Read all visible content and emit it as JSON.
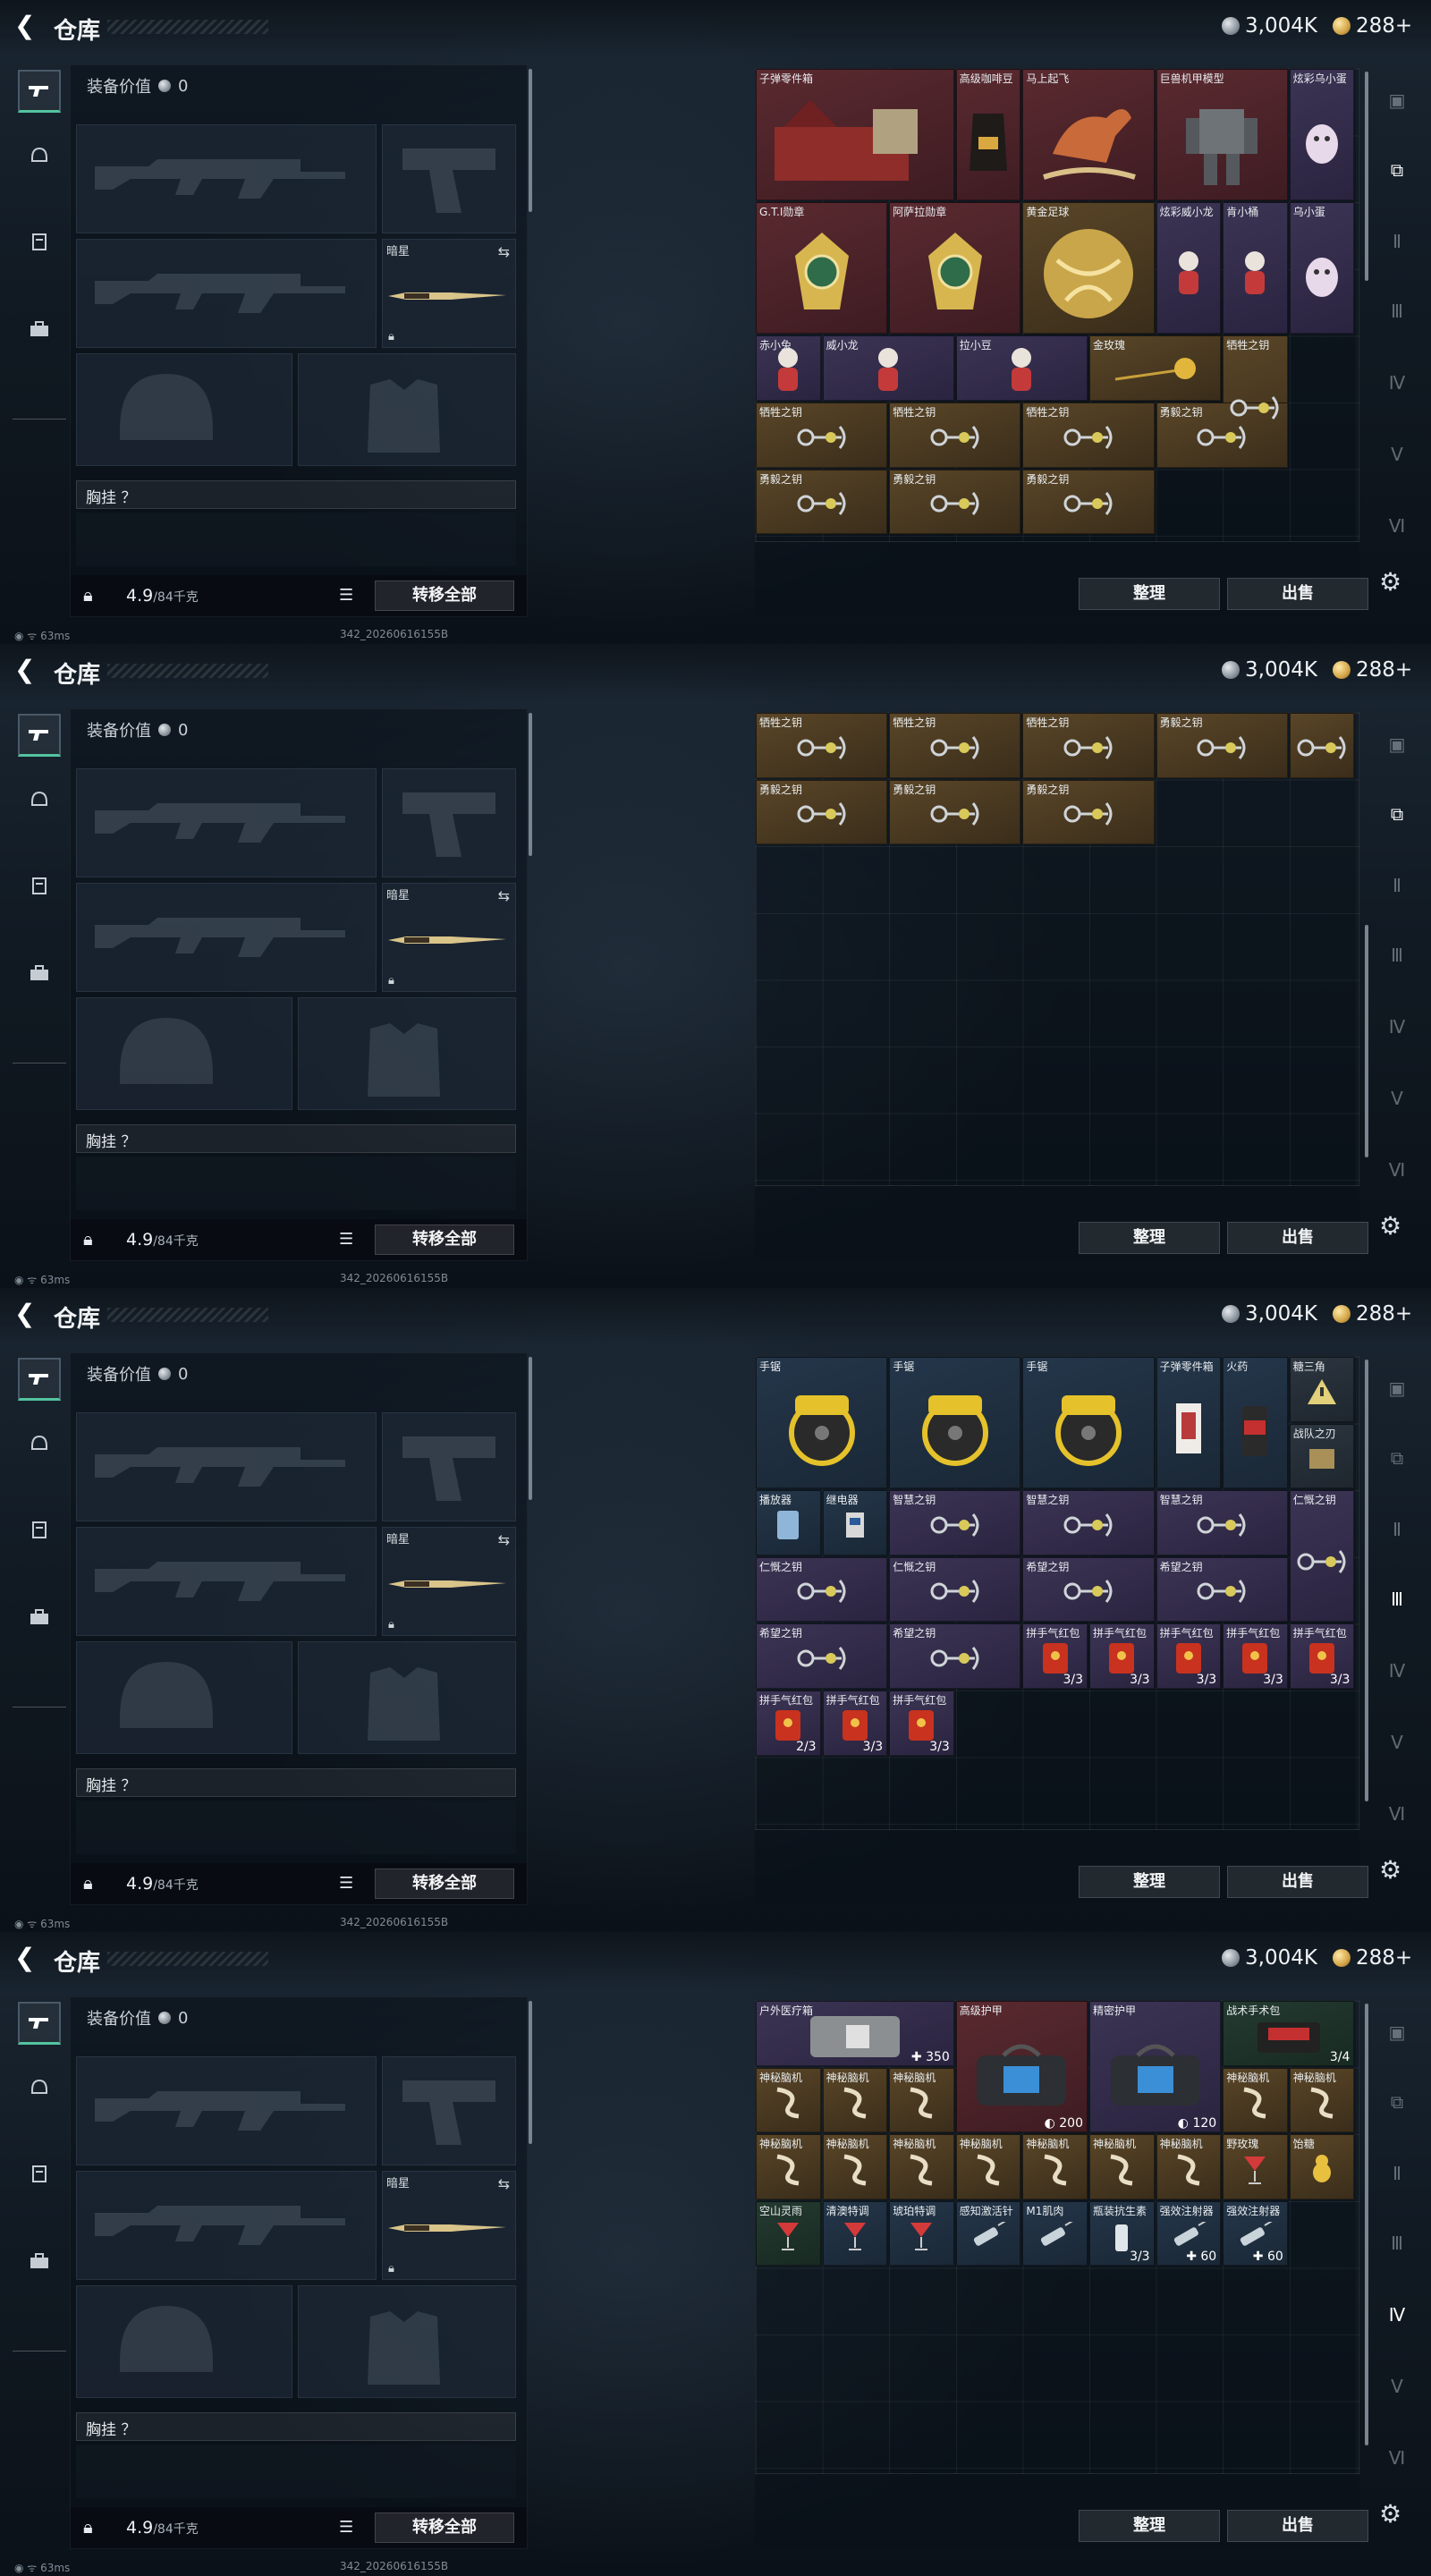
{
  "header": {
    "title": "仓库",
    "silver": "3,004K",
    "gold": "288+"
  },
  "equipment": {
    "value_label": "装备价值",
    "value": "0",
    "melee_label": "暗星",
    "rig_label": "胸挂 ？",
    "weight_value": "4.9",
    "weight_max": "/84千克",
    "transfer_button": "转移全部"
  },
  "footer": {
    "ping": "63ms",
    "build": "342_20260616155B"
  },
  "stash_buttons": {
    "sort": "整理",
    "sell": "出售"
  },
  "screens": [
    {
      "items": [
        {
          "name": "子弹零件箱",
          "c": 0,
          "r": 0,
          "w": 3,
          "h": 2,
          "col": "red",
          "icon": "toolbox-icon"
        },
        {
          "name": "高级咖啡豆",
          "c": 3,
          "r": 0,
          "w": 1,
          "h": 2,
          "col": "red",
          "icon": "coffee-bag-icon"
        },
        {
          "name": "马上起飞",
          "c": 4,
          "r": 0,
          "w": 2,
          "h": 2,
          "col": "red",
          "icon": "rocking-horse-icon"
        },
        {
          "name": "巨兽机甲模型",
          "c": 6,
          "r": 0,
          "w": 2,
          "h": 2,
          "col": "red",
          "icon": "mech-model-icon"
        },
        {
          "name": "炫彩乌小蛋",
          "c": 8,
          "r": 0,
          "w": 1,
          "h": 2,
          "col": "purple",
          "icon": "egg-toy-icon"
        },
        {
          "name": "G.T.I勋章",
          "c": 0,
          "r": 2,
          "w": 2,
          "h": 2,
          "col": "red",
          "icon": "medal-icon"
        },
        {
          "name": "阿萨拉勋章",
          "c": 2,
          "r": 2,
          "w": 2,
          "h": 2,
          "col": "red",
          "icon": "medal-icon"
        },
        {
          "name": "黄金足球",
          "c": 4,
          "r": 2,
          "w": 2,
          "h": 2,
          "col": "gold",
          "icon": "gold-ball-icon"
        },
        {
          "name": "炫彩威小龙",
          "c": 6,
          "r": 2,
          "w": 1,
          "h": 2,
          "col": "purple",
          "icon": "figure-icon"
        },
        {
          "name": "肯小桶",
          "c": 7,
          "r": 2,
          "w": 1,
          "h": 2,
          "col": "purple",
          "icon": "figure-icon"
        },
        {
          "name": "乌小蛋",
          "c": 8,
          "r": 2,
          "w": 1,
          "h": 2,
          "col": "purple",
          "icon": "egg-toy-icon"
        },
        {
          "name": "赤小兔",
          "c": 0,
          "r": 4,
          "w": 1,
          "h": 1,
          "col": "purple",
          "icon": "figure-icon"
        },
        {
          "name": "威小龙",
          "c": 1,
          "r": 4,
          "w": 2,
          "h": 1,
          "col": "purple",
          "icon": "figure-icon"
        },
        {
          "name": "拉小豆",
          "c": 3,
          "r": 4,
          "w": 2,
          "h": 1,
          "col": "purple",
          "icon": "figure-icon"
        },
        {
          "name": "金玫瑰",
          "c": 5,
          "r": 4,
          "w": 2,
          "h": 1,
          "col": "gold",
          "icon": "rose-icon"
        },
        {
          "name": "牺牲之钥",
          "c": 7,
          "r": 4,
          "w": 1,
          "h": 2,
          "col": "gold",
          "icon": "key-icon"
        },
        {
          "name": "牺牲之钥",
          "c": 0,
          "r": 5,
          "w": 2,
          "h": 1,
          "col": "gold",
          "icon": "key-icon"
        },
        {
          "name": "牺牲之钥",
          "c": 2,
          "r": 5,
          "w": 2,
          "h": 1,
          "col": "gold",
          "icon": "key-icon"
        },
        {
          "name": "牺牲之钥",
          "c": 4,
          "r": 5,
          "w": 2,
          "h": 1,
          "col": "gold",
          "icon": "key-icon"
        },
        {
          "name": "勇毅之钥",
          "c": 6,
          "r": 5,
          "w": 2,
          "h": 1,
          "col": "gold",
          "icon": "key-icon"
        },
        {
          "name": "勇毅之钥",
          "c": 0,
          "r": 6,
          "w": 2,
          "h": 1,
          "col": "gold",
          "icon": "key-icon"
        },
        {
          "name": "勇毅之钥",
          "c": 2,
          "r": 6,
          "w": 2,
          "h": 1,
          "col": "gold",
          "icon": "key-icon"
        },
        {
          "name": "勇毅之钥",
          "c": 4,
          "r": 6,
          "w": 2,
          "h": 1,
          "col": "gold",
          "icon": "key-icon"
        }
      ],
      "scroll": {
        "top": 0,
        "len": 0.45
      },
      "active_tab": 1
    },
    {
      "items": [
        {
          "name": "牺牲之钥",
          "c": 0,
          "r": 0,
          "w": 2,
          "h": 1,
          "col": "gold",
          "icon": "key-icon"
        },
        {
          "name": "牺牲之钥",
          "c": 2,
          "r": 0,
          "w": 2,
          "h": 1,
          "col": "gold",
          "icon": "key-icon"
        },
        {
          "name": "牺牲之钥",
          "c": 4,
          "r": 0,
          "w": 2,
          "h": 1,
          "col": "gold",
          "icon": "key-icon"
        },
        {
          "name": "勇毅之钥",
          "c": 6,
          "r": 0,
          "w": 2,
          "h": 1,
          "col": "gold",
          "icon": "key-icon"
        },
        {
          "name": "",
          "c": 8,
          "r": 0,
          "w": 1,
          "h": 1,
          "col": "gold",
          "icon": "key-icon"
        },
        {
          "name": "勇毅之钥",
          "c": 0,
          "r": 1,
          "w": 2,
          "h": 1,
          "col": "gold",
          "icon": "key-icon"
        },
        {
          "name": "勇毅之钥",
          "c": 2,
          "r": 1,
          "w": 2,
          "h": 1,
          "col": "gold",
          "icon": "key-icon"
        },
        {
          "name": "勇毅之钥",
          "c": 4,
          "r": 1,
          "w": 2,
          "h": 1,
          "col": "gold",
          "icon": "key-icon"
        }
      ],
      "scroll": {
        "top": 0.45,
        "len": 0.5
      },
      "active_tab": 1
    },
    {
      "items": [
        {
          "name": "手锯",
          "c": 0,
          "r": 0,
          "w": 2,
          "h": 2,
          "col": "blue",
          "icon": "saw-icon"
        },
        {
          "name": "手锯",
          "c": 2,
          "r": 0,
          "w": 2,
          "h": 2,
          "col": "blue",
          "icon": "saw-icon"
        },
        {
          "name": "手锯",
          "c": 4,
          "r": 0,
          "w": 2,
          "h": 2,
          "col": "blue",
          "icon": "saw-icon"
        },
        {
          "name": "子弹零件箱",
          "c": 6,
          "r": 0,
          "w": 1,
          "h": 2,
          "col": "blue",
          "icon": "card-icon"
        },
        {
          "name": "火药",
          "c": 7,
          "r": 0,
          "w": 1,
          "h": 2,
          "col": "blue",
          "icon": "powder-icon"
        },
        {
          "name": "糖三角",
          "c": 8,
          "r": 0,
          "w": 1,
          "h": 1,
          "col": "gray",
          "icon": "warning-icon"
        },
        {
          "name": "战队之刃",
          "c": 8,
          "r": 1,
          "w": 1,
          "h": 1,
          "col": "gray",
          "icon": "box-icon"
        },
        {
          "name": "播放器",
          "c": 0,
          "r": 2,
          "w": 1,
          "h": 1,
          "col": "blue",
          "icon": "player-icon"
        },
        {
          "name": "继电器",
          "c": 1,
          "r": 2,
          "w": 1,
          "h": 1,
          "col": "blue",
          "icon": "relay-icon"
        },
        {
          "name": "智慧之钥",
          "c": 2,
          "r": 2,
          "w": 2,
          "h": 1,
          "col": "purple",
          "icon": "key-icon"
        },
        {
          "name": "智慧之钥",
          "c": 4,
          "r": 2,
          "w": 2,
          "h": 1,
          "col": "purple",
          "icon": "key-icon"
        },
        {
          "name": "智慧之钥",
          "c": 6,
          "r": 2,
          "w": 2,
          "h": 1,
          "col": "purple",
          "icon": "key-icon"
        },
        {
          "name": "仁慨之钥",
          "c": 8,
          "r": 2,
          "w": 1,
          "h": 2,
          "col": "purple",
          "icon": "key-icon"
        },
        {
          "name": "仁慨之钥",
          "c": 0,
          "r": 3,
          "w": 2,
          "h": 1,
          "col": "purple",
          "icon": "key-icon"
        },
        {
          "name": "仁慨之钥",
          "c": 2,
          "r": 3,
          "w": 2,
          "h": 1,
          "col": "purple",
          "icon": "key-icon"
        },
        {
          "name": "希望之钥",
          "c": 4,
          "r": 3,
          "w": 2,
          "h": 1,
          "col": "purple",
          "icon": "key-icon"
        },
        {
          "name": "希望之钥",
          "c": 6,
          "r": 3,
          "w": 2,
          "h": 1,
          "col": "purple",
          "icon": "key-icon"
        },
        {
          "name": "希望之钥",
          "c": 0,
          "r": 4,
          "w": 2,
          "h": 1,
          "col": "purple",
          "icon": "key-icon"
        },
        {
          "name": "希望之钥",
          "c": 2,
          "r": 4,
          "w": 2,
          "h": 1,
          "col": "purple",
          "icon": "key-icon"
        },
        {
          "name": "拼手气红包",
          "c": 4,
          "r": 4,
          "w": 1,
          "h": 1,
          "col": "purple",
          "icon": "red-envelope-icon",
          "count": "3/3"
        },
        {
          "name": "拼手气红包",
          "c": 5,
          "r": 4,
          "w": 1,
          "h": 1,
          "col": "purple",
          "icon": "red-envelope-icon",
          "count": "3/3"
        },
        {
          "name": "拼手气红包",
          "c": 6,
          "r": 4,
          "w": 1,
          "h": 1,
          "col": "purple",
          "icon": "red-envelope-icon",
          "count": "3/3"
        },
        {
          "name": "拼手气红包",
          "c": 7,
          "r": 4,
          "w": 1,
          "h": 1,
          "col": "purple",
          "icon": "red-envelope-icon",
          "count": "3/3"
        },
        {
          "name": "拼手气红包",
          "c": 8,
          "r": 4,
          "w": 1,
          "h": 1,
          "col": "purple",
          "icon": "red-envelope-icon",
          "count": "3/3"
        },
        {
          "name": "拼手气红包",
          "c": 0,
          "r": 5,
          "w": 1,
          "h": 1,
          "col": "purple",
          "icon": "red-envelope-icon",
          "count": "2/3"
        },
        {
          "name": "拼手气红包",
          "c": 1,
          "r": 5,
          "w": 1,
          "h": 1,
          "col": "purple",
          "icon": "red-envelope-icon",
          "count": "3/3"
        },
        {
          "name": "拼手气红包",
          "c": 2,
          "r": 5,
          "w": 1,
          "h": 1,
          "col": "purple",
          "icon": "red-envelope-icon",
          "count": "3/3"
        }
      ],
      "scroll": {
        "top": 0,
        "len": 0.95
      },
      "active_tab": 3
    },
    {
      "items": [
        {
          "name": "户外医疗箱",
          "c": 0,
          "r": 0,
          "w": 3,
          "h": 1,
          "col": "purple",
          "icon": "medkit-icon",
          "count": "✚ 350"
        },
        {
          "name": "高级护甲",
          "c": 3,
          "r": 0,
          "w": 2,
          "h": 2,
          "col": "red",
          "icon": "armor-bag-icon",
          "count": "◐ 200"
        },
        {
          "name": "精密护甲",
          "c": 5,
          "r": 0,
          "w": 2,
          "h": 2,
          "col": "purple",
          "icon": "armor-bag-icon",
          "count": "◐ 120"
        },
        {
          "name": "战术手术包",
          "c": 7,
          "r": 0,
          "w": 2,
          "h": 1,
          "col": "green",
          "icon": "surgery-kit-icon",
          "count": "3/4"
        },
        {
          "name": "神秘脑机",
          "c": 0,
          "r": 1,
          "w": 1,
          "h": 1,
          "col": "gold",
          "icon": "cable-icon"
        },
        {
          "name": "神秘脑机",
          "c": 1,
          "r": 1,
          "w": 1,
          "h": 1,
          "col": "gold",
          "icon": "cable-icon"
        },
        {
          "name": "神秘脑机",
          "c": 2,
          "r": 1,
          "w": 1,
          "h": 1,
          "col": "gold",
          "icon": "cable-icon"
        },
        {
          "name": "神秘脑机",
          "c": 7,
          "r": 1,
          "w": 1,
          "h": 1,
          "col": "gold",
          "icon": "cable-icon"
        },
        {
          "name": "神秘脑机",
          "c": 8,
          "r": 1,
          "w": 1,
          "h": 1,
          "col": "gold",
          "icon": "cable-icon"
        },
        {
          "name": "神秘脑机",
          "c": 0,
          "r": 2,
          "w": 1,
          "h": 1,
          "col": "gold",
          "icon": "cable-icon"
        },
        {
          "name": "神秘脑机",
          "c": 1,
          "r": 2,
          "w": 1,
          "h": 1,
          "col": "gold",
          "icon": "cable-icon"
        },
        {
          "name": "神秘脑机",
          "c": 2,
          "r": 2,
          "w": 1,
          "h": 1,
          "col": "gold",
          "icon": "cable-icon"
        },
        {
          "name": "神秘脑机",
          "c": 3,
          "r": 2,
          "w": 1,
          "h": 1,
          "col": "gold",
          "icon": "cable-icon"
        },
        {
          "name": "神秘脑机",
          "c": 4,
          "r": 2,
          "w": 1,
          "h": 1,
          "col": "gold",
          "icon": "cable-icon"
        },
        {
          "name": "神秘脑机",
          "c": 5,
          "r": 2,
          "w": 1,
          "h": 1,
          "col": "gold",
          "icon": "cable-icon"
        },
        {
          "name": "神秘脑机",
          "c": 6,
          "r": 2,
          "w": 1,
          "h": 1,
          "col": "gold",
          "icon": "cable-icon"
        },
        {
          "name": "野玫瑰",
          "c": 7,
          "r": 2,
          "w": 1,
          "h": 1,
          "col": "gold",
          "icon": "cocktail-icon"
        },
        {
          "name": "饴糖",
          "c": 8,
          "r": 2,
          "w": 1,
          "h": 1,
          "col": "gold",
          "icon": "duck-icon"
        },
        {
          "name": "空山灵雨",
          "c": 0,
          "r": 3,
          "w": 1,
          "h": 1,
          "col": "green",
          "icon": "cocktail-icon"
        },
        {
          "name": "清澳特调",
          "c": 1,
          "r": 3,
          "w": 1,
          "h": 1,
          "col": "blue",
          "icon": "cocktail-icon"
        },
        {
          "name": "琥珀特调",
          "c": 2,
          "r": 3,
          "w": 1,
          "h": 1,
          "col": "blue",
          "icon": "cocktail-icon"
        },
        {
          "name": "感知激活针",
          "c": 3,
          "r": 3,
          "w": 1,
          "h": 1,
          "col": "blue",
          "icon": "syringe-icon"
        },
        {
          "name": "M1肌肉",
          "c": 4,
          "r": 3,
          "w": 1,
          "h": 1,
          "col": "blue",
          "icon": "syringe-icon"
        },
        {
          "name": "瓶装抗生素",
          "c": 5,
          "r": 3,
          "w": 1,
          "h": 1,
          "col": "blue",
          "icon": "bottle-icon",
          "count": "3/3"
        },
        {
          "name": "强效注射器",
          "c": 6,
          "r": 3,
          "w": 1,
          "h": 1,
          "col": "blue",
          "icon": "syringe-icon",
          "count": "✚ 60"
        },
        {
          "name": "强效注射器",
          "c": 7,
          "r": 3,
          "w": 1,
          "h": 1,
          "col": "blue",
          "icon": "syringe-icon",
          "count": "✚ 60"
        }
      ],
      "scroll": {
        "top": 0,
        "len": 0.95
      },
      "active_tab": 4
    }
  ]
}
